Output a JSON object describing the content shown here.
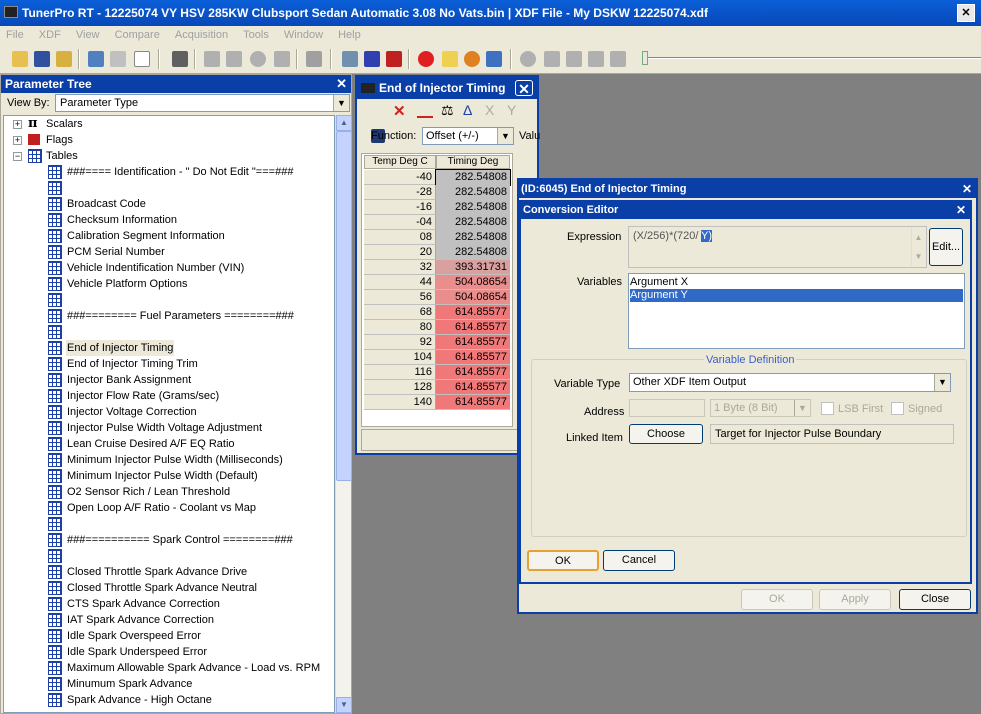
{
  "app": {
    "title": "TunerPro RT - 12225074 VY HSV 285KW Clubsport Sedan Automatic 3.08 No Vats.bin | XDF File - My DSKW  12225074.xdf"
  },
  "menu": [
    "File",
    "XDF",
    "View",
    "Compare",
    "Acquisition",
    "Tools",
    "Window",
    "Help"
  ],
  "parameter_tree": {
    "title": "Parameter Tree",
    "view_by_label": "View By:",
    "view_by_value": "Parameter Type",
    "categories": [
      "Scalars",
      "Flags",
      "Tables"
    ],
    "tables": [
      "###==== Identification - \" Do Not Edit \"===###",
      "",
      "Broadcast Code",
      "Checksum Information",
      "Calibration Segment Information",
      "PCM Serial Number",
      "Vehicle Indentification Number (VIN)",
      "Vehicle Platform Options",
      "",
      "###======== Fuel Parameters ========###",
      "",
      "End of Injector Timing",
      "End of Injector Timing Trim",
      "Injector Bank Assignment",
      "Injector Flow Rate (Grams/sec)",
      "Injector Voltage Correction",
      "Injector Pulse Width Voltage Adjustment",
      "Lean Cruise Desired A/F EQ Ratio",
      "Minimum Injector Pulse Width (Milliseconds)",
      "Minimum Injector Pulse Width (Default)",
      "O2 Sensor Rich / Lean Threshold",
      "Open Loop A/F Ratio - Coolant vs Map",
      "",
      "###========== Spark Control ========###",
      "",
      "Closed Throttle Spark Advance Drive",
      "Closed Throttle Spark Advance Neutral",
      "CTS Spark Advance Correction",
      "IAT Spark Advance Correction",
      "Idle Spark Overspeed Error",
      "Idle Spark Underspeed Error",
      "Maximum Allowable Spark Advance - Load vs. RPM",
      "Minumum Spark Advance",
      "Spark Advance - High Octane"
    ],
    "selected_index": 11
  },
  "table_window": {
    "title": "End of Injector Timing",
    "function_label": "Function:",
    "function_value": "Offset (+/-)",
    "value_label": "Valu",
    "col_headers": [
      "Temp Deg C",
      "Timing Deg"
    ],
    "rows": [
      [
        "-40",
        "282.54808"
      ],
      [
        "-28",
        "282.54808"
      ],
      [
        "-16",
        "282.54808"
      ],
      [
        "-04",
        "282.54808"
      ],
      [
        "08",
        "282.54808"
      ],
      [
        "20",
        "282.54808"
      ],
      [
        "32",
        "393.31731"
      ],
      [
        "44",
        "504.08654"
      ],
      [
        "56",
        "504.08654"
      ],
      [
        "68",
        "614.85577"
      ],
      [
        "80",
        "614.85577"
      ],
      [
        "92",
        "614.85577"
      ],
      [
        "104",
        "614.85577"
      ],
      [
        "116",
        "614.85577"
      ],
      [
        "128",
        "614.85577"
      ],
      [
        "140",
        "614.85577"
      ]
    ],
    "cell_colors": [
      "#c0c0c0",
      "#c0c0c0",
      "#c0c0c0",
      "#c0c0c0",
      "#c0c0c0",
      "#c0c0c0",
      "#d9a0a0",
      "#ea8d8d",
      "#ea8d8d",
      "#f07878",
      "#f07878",
      "#f07878",
      "#f07878",
      "#f07878",
      "#f07878",
      "#f07878"
    ]
  },
  "constant_window": {
    "title": "(ID:6045) End of Injector Timing",
    "ok": "OK",
    "apply": "Apply",
    "close": "Close"
  },
  "conversion_editor": {
    "title": "Conversion Editor",
    "expression_label": "Expression",
    "expression_value": "(X/256)*(720/",
    "expression_selected": "Y)",
    "edit_button": "Edit...",
    "variables_label": "Variables",
    "variables": [
      "Argument X",
      "Argument Y"
    ],
    "selected_variable": 1,
    "group_label": "Variable Definition",
    "variable_type_label": "Variable Type",
    "variable_type_value": "Other XDF Item Output",
    "address_label": "Address",
    "address_size": "1 Byte (8 Bit)",
    "lsb_first": "LSB First",
    "signed": "Signed",
    "linked_item_label": "Linked Item",
    "choose_button": "Choose",
    "linked_item_value": "Target for Injector Pulse Boundary",
    "ok": "OK",
    "cancel": "Cancel"
  }
}
